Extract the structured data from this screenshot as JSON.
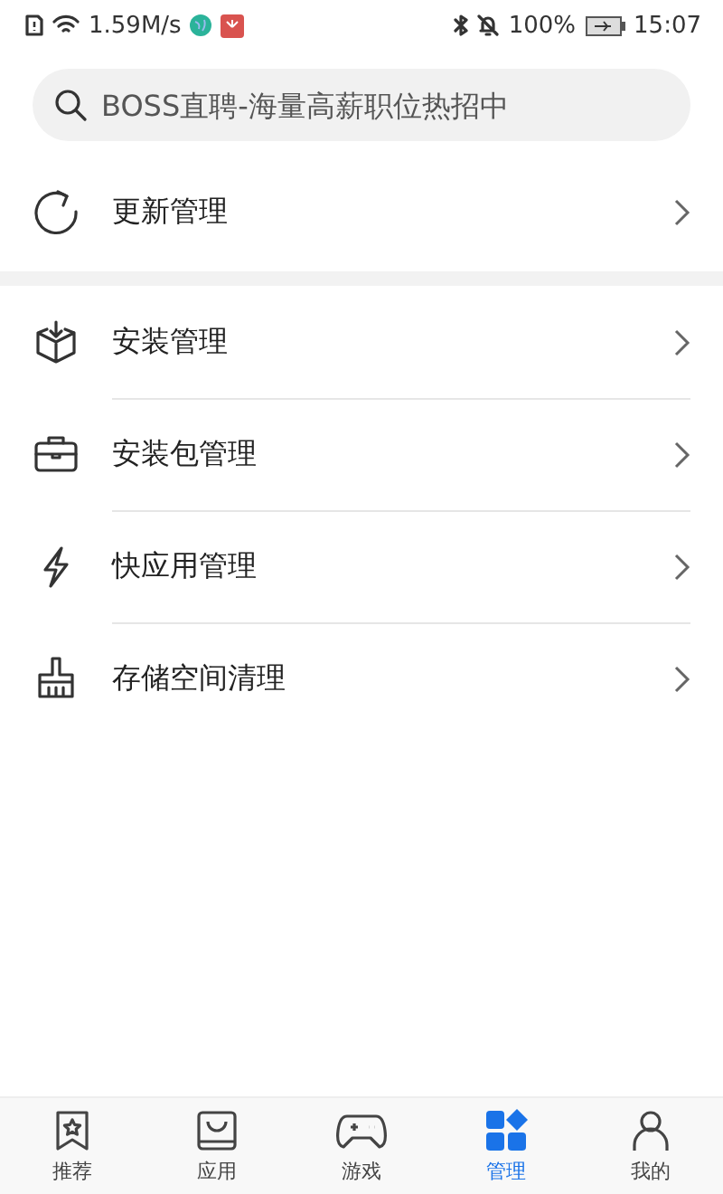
{
  "status_bar": {
    "speed": "1.59M/s",
    "battery": "100%",
    "time": "15:07"
  },
  "search": {
    "placeholder": "BOSS直聘-海量高薪职位热招中"
  },
  "sections": [
    {
      "items": [
        {
          "label": "更新管理"
        }
      ]
    },
    {
      "items": [
        {
          "label": "安装管理"
        },
        {
          "label": "安装包管理"
        },
        {
          "label": "快应用管理"
        },
        {
          "label": "存储空间清理"
        }
      ]
    }
  ],
  "tabs": [
    {
      "label": "推荐",
      "selected": false
    },
    {
      "label": "应用",
      "selected": false
    },
    {
      "label": "游戏",
      "selected": false
    },
    {
      "label": "管理",
      "selected": true
    },
    {
      "label": "我的",
      "selected": false
    }
  ]
}
